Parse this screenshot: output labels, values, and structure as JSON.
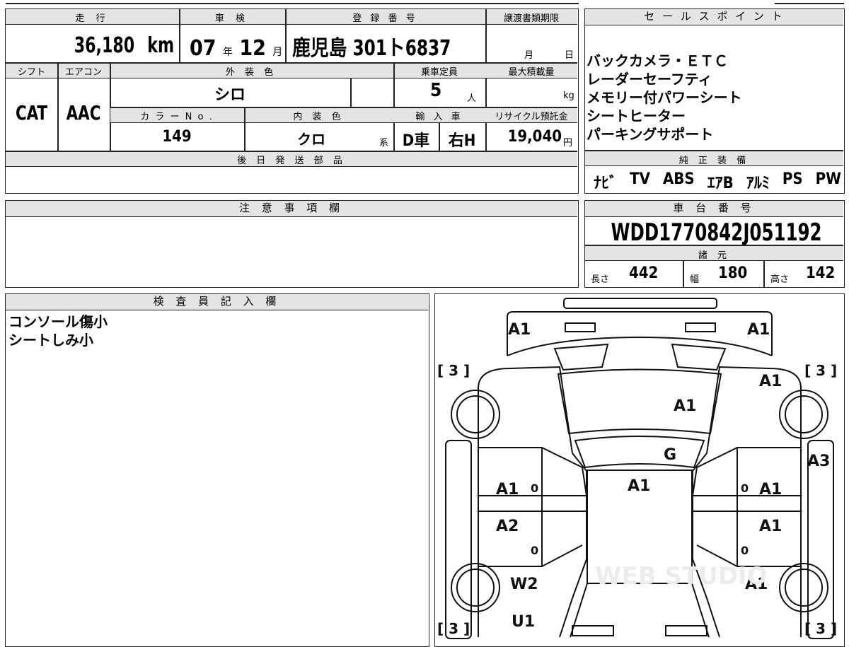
{
  "main": {
    "mileage_label": "走 行",
    "mileage_value": "36,180",
    "mileage_unit": "km",
    "inspection_label": "車 検",
    "inspection_year": "07",
    "inspection_year_unit": "年",
    "inspection_month": "12",
    "inspection_month_unit": "月",
    "registration_label": "登 録 番 号",
    "registration_value": "鹿児島 301ト6837",
    "transfer_label": "譲渡書類期限",
    "transfer_month_unit": "月",
    "transfer_day_unit": "日",
    "shift_label": "シフト",
    "shift_value": "CAT",
    "aircon_label": "エアコン",
    "aircon_value": "AAC",
    "exterior_label": "外 装 色",
    "exterior_value": "シロ",
    "capacity_label": "乗車定員",
    "capacity_value": "5",
    "capacity_unit": "人",
    "load_label": "最大積載量",
    "load_unit": "kg",
    "color_no_label": "カ ラ ー N o .",
    "color_no_value": "149",
    "interior_label": "内 装 色",
    "interior_value": "クロ",
    "interior_suffix": "系",
    "import_label": "輸 入 車",
    "import_value1": "D車",
    "import_value2": "右H",
    "recycle_label": "リサイクル預託金",
    "recycle_value": "19,040",
    "recycle_unit": "円",
    "later_parts_label": "後 日 発 送 部 品"
  },
  "sales": {
    "label": "セ ー ル ス ポ イ ン ト",
    "points": [
      "バックカメラ・ＥＴＣ",
      "レーダーセーフティ",
      "メモリー付パワーシート",
      "シートヒーター",
      "パーキングサポート"
    ]
  },
  "equipment": {
    "label": "純 正 装 備",
    "items": [
      "ﾅﾋﾞ",
      "TV",
      "ABS",
      "ｴｱB",
      "ｱﾙﾐ",
      "PS",
      "PW"
    ]
  },
  "notes": {
    "label": "注 意 事 項 欄"
  },
  "chassis": {
    "label": "車 台 番 号",
    "value": "WDD1770842J051192",
    "spec_label": "諸 元",
    "length_label": "長さ",
    "length_value": "442",
    "width_label": "幅",
    "width_value": "180",
    "height_label": "高さ",
    "height_value": "142"
  },
  "inspector": {
    "label": "検 査 員 記 入 欄",
    "lines": [
      "コンソール傷小",
      "シートしみ小"
    ]
  },
  "diagram": {
    "marks": [
      "A1",
      "A1",
      "A1",
      "A1",
      "G",
      "A1",
      "A3",
      "A1",
      "A1",
      "A2",
      "A1",
      "W2",
      "A1",
      "U1"
    ],
    "tire_marks": [
      "[ 3 ]",
      "[ 3 ]",
      "[ 3 ]",
      "[ 3 ]"
    ],
    "zeros": [
      "0",
      "0",
      "0",
      "0"
    ],
    "watermark": "WEB STUDIO"
  }
}
